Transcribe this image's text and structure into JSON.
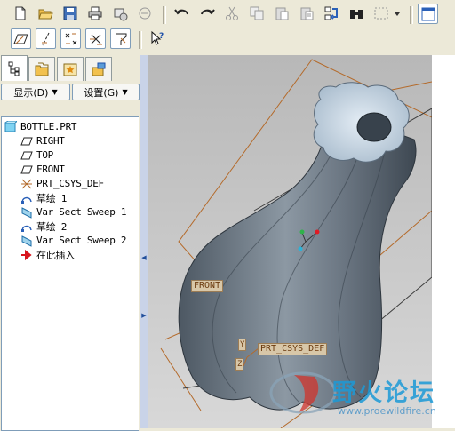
{
  "panel": {
    "display_label": "显示(D)",
    "settings_label": "设置(G)"
  },
  "tree": {
    "items": [
      {
        "label": "BOTTLE.PRT",
        "icon": "part-icon"
      },
      {
        "label": "RIGHT",
        "icon": "datum-plane-icon"
      },
      {
        "label": "TOP",
        "icon": "datum-plane-icon"
      },
      {
        "label": "FRONT",
        "icon": "datum-plane-icon"
      },
      {
        "label": "PRT_CSYS_DEF",
        "icon": "csys-icon"
      },
      {
        "label": "草绘 1",
        "icon": "sketch-icon"
      },
      {
        "label": "Var Sect Sweep 1",
        "icon": "sweep-icon"
      },
      {
        "label": "草绘 2",
        "icon": "sketch-icon"
      },
      {
        "label": "Var Sect Sweep 2",
        "icon": "sweep-icon"
      },
      {
        "label": "在此插入",
        "icon": "insert-here-icon"
      }
    ]
  },
  "viewport": {
    "front_label": "FRONT",
    "csys_label": "PRT_CSYS_DEF",
    "axis_y": "Y",
    "axis_z": "Z"
  },
  "watermark": {
    "title": "野火论坛",
    "url": "www.proewildfire.cn"
  },
  "colors": {
    "chrome": "#ece9d8",
    "datum": "#b46a2a",
    "model": "#7d8a96",
    "watermark": "#1c9ad7"
  }
}
